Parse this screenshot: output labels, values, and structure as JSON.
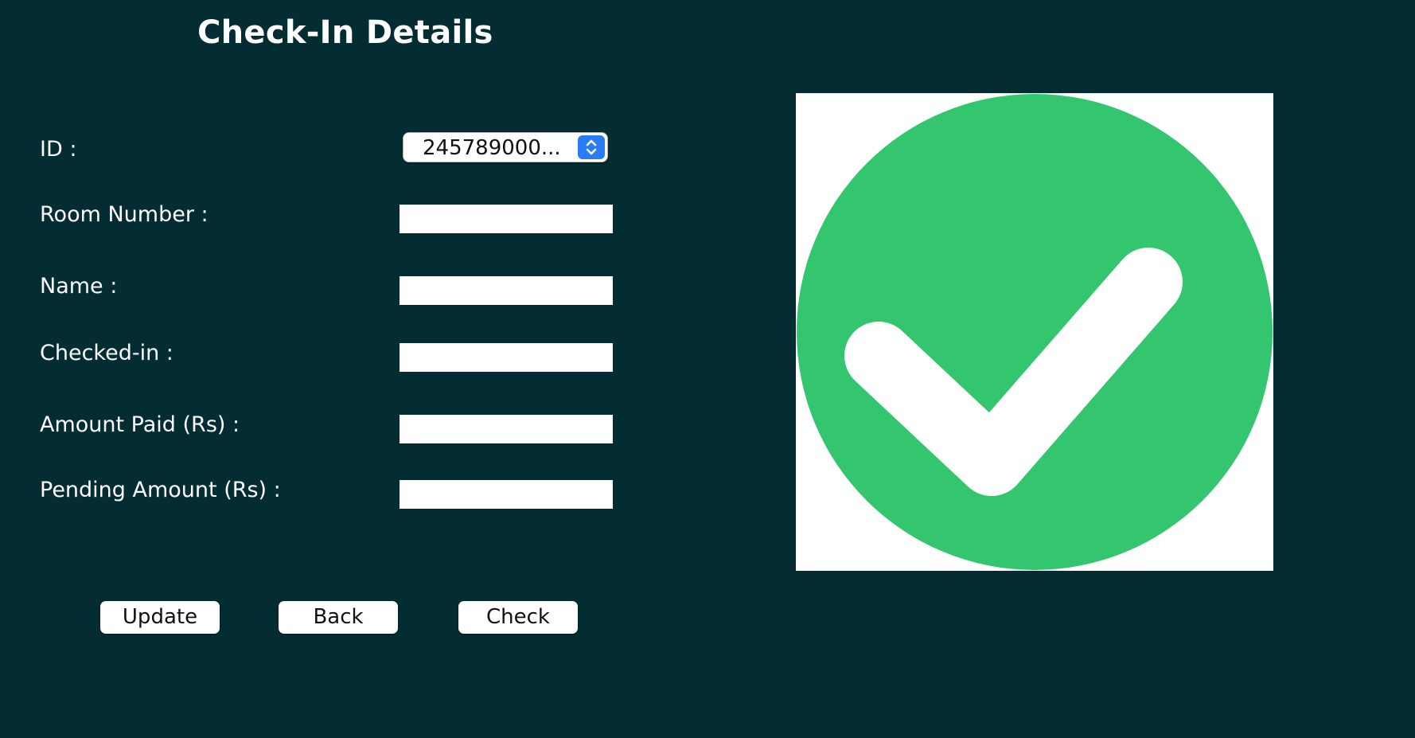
{
  "window": {
    "title": "Check-In Details"
  },
  "form": {
    "id_label": "ID :",
    "id_value": "245789000...",
    "room_number_label": "Room Number :",
    "name_label": "Name :",
    "checked_in_label": "Checked-in :",
    "amount_paid_label": "Amount Paid (Rs) :",
    "pending_amount_label": "Pending Amount (Rs) :",
    "room_number_value": "",
    "name_value": "",
    "checked_in_value": "",
    "amount_paid_value": "",
    "pending_amount_value": ""
  },
  "buttons": {
    "update": "Update",
    "back": "Back",
    "check": "Check"
  },
  "colors": {
    "background": "#042c33",
    "check_green": "#33c66e",
    "select_accent": "#2c7bf6"
  },
  "icons": {
    "status_image": "checkmark-circle-icon",
    "select_arrows": "chevron-up-down-icon"
  }
}
